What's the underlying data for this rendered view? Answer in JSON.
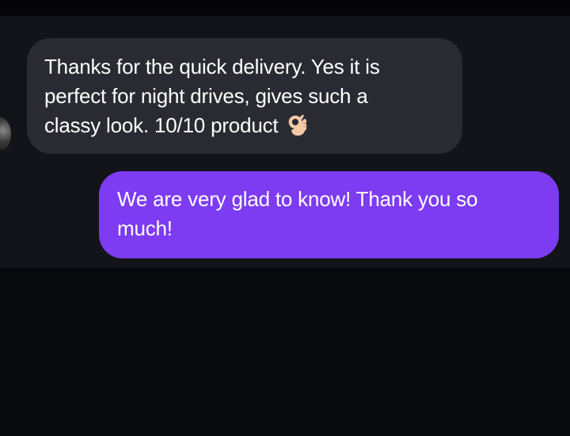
{
  "conversation": {
    "messages": [
      {
        "direction": "incoming",
        "lines": [
          "Thanks for the quick delivery. Yes it is",
          "perfect for night drives, gives such a",
          "classy look. 10/10 product"
        ],
        "emoji": "ok-hand-icon"
      },
      {
        "direction": "outgoing",
        "lines": [
          "We are very glad to know! Thank you so",
          "much!"
        ]
      }
    ]
  },
  "colors": {
    "background": "#08090c",
    "chat_background": "#131419",
    "incoming_bubble": "#2a2b32",
    "outgoing_bubble": "#7d3bf2",
    "text": "#ffffff"
  }
}
